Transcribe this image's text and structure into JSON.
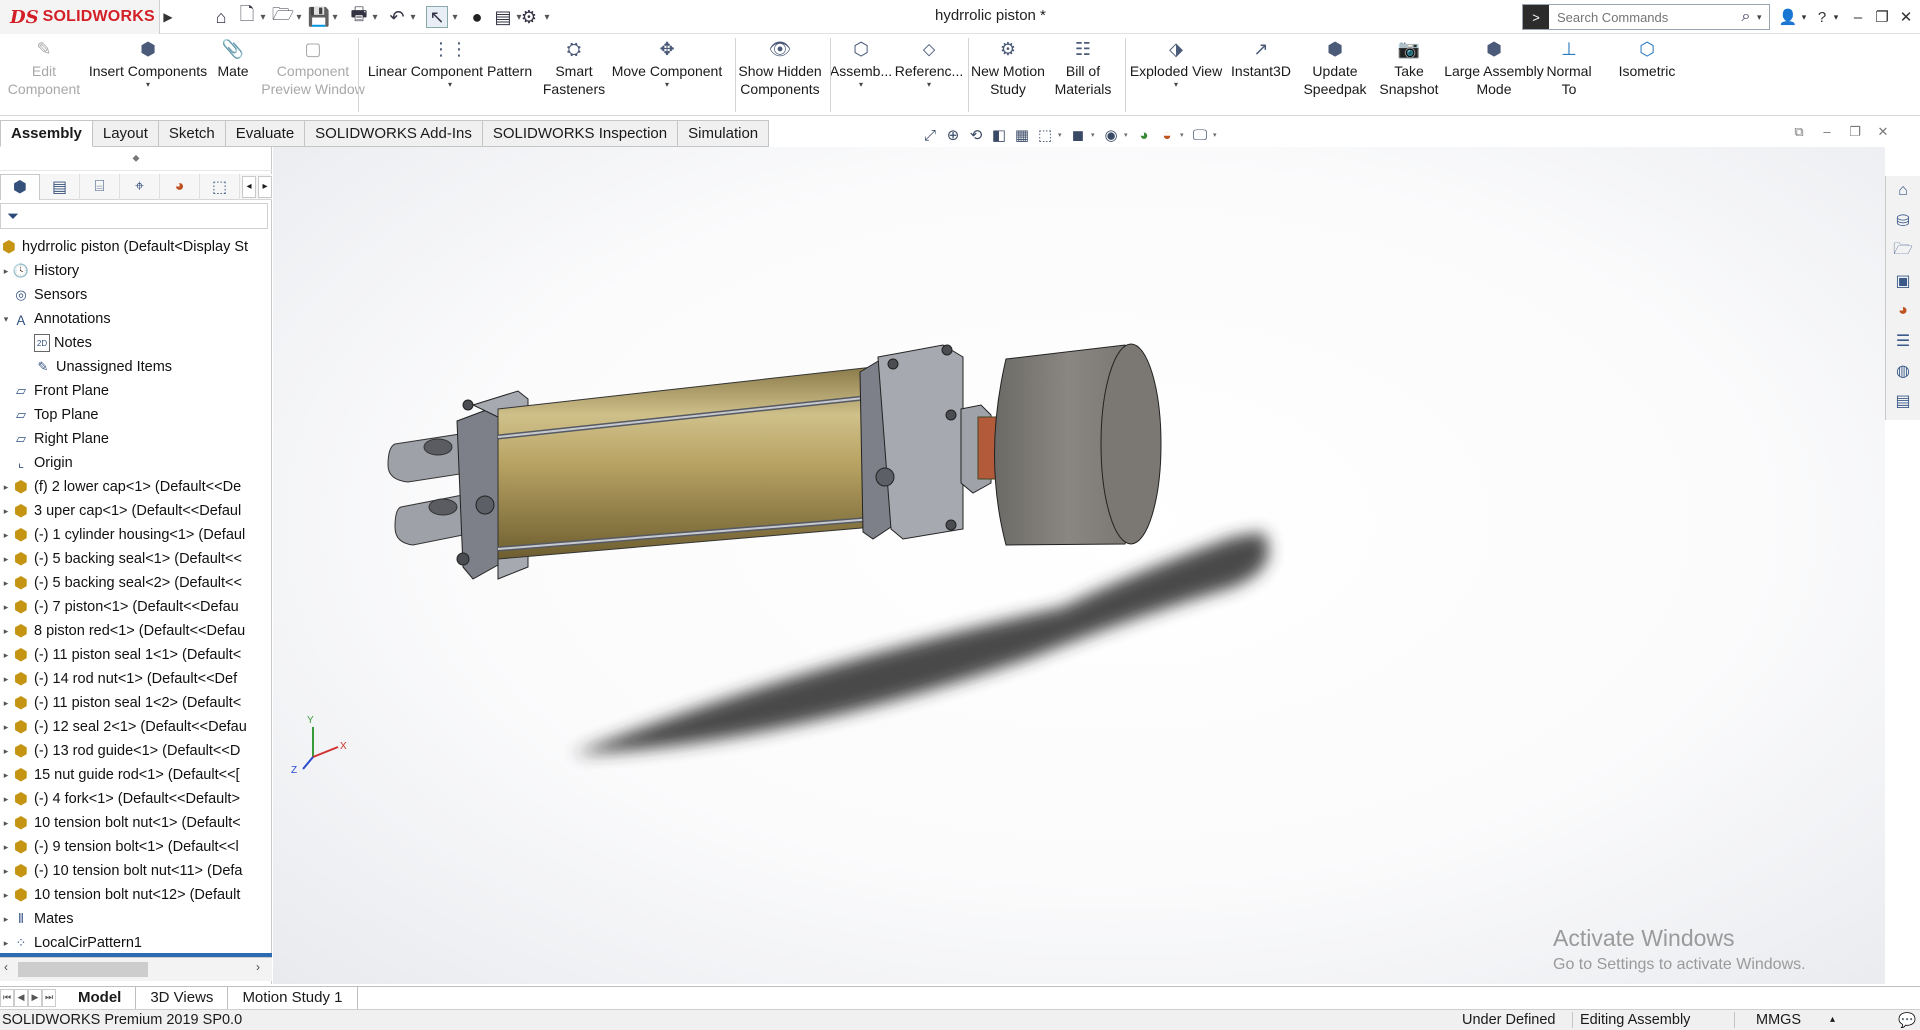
{
  "app": {
    "brand_mark": "DS",
    "brand_name": "SOLIDWORKS",
    "document_title": "hydrrolic piston *"
  },
  "search": {
    "placeholder": "Search Commands"
  },
  "command_manager": [
    {
      "label": "Edit\nComponent",
      "icon": "edit-component-icon",
      "enabled": false
    },
    {
      "label": "Insert Components",
      "icon": "insert-components-icon",
      "enabled": true
    },
    {
      "label": "Mate",
      "icon": "mate-icon",
      "enabled": true
    },
    {
      "label": "Component\nPreview Window",
      "icon": "preview-window-icon",
      "enabled": false
    },
    {
      "label": "Linear Component Pattern",
      "icon": "linear-pattern-icon",
      "enabled": true
    },
    {
      "label": "Smart\nFasteners",
      "icon": "smart-fasteners-icon",
      "enabled": true
    },
    {
      "label": "Move Component",
      "icon": "move-component-icon",
      "enabled": true
    },
    {
      "label": "Show Hidden\nComponents",
      "icon": "show-hidden-icon",
      "enabled": true
    },
    {
      "label": "Assemb...",
      "icon": "assembly-features-icon",
      "enabled": true
    },
    {
      "label": "Referenc...",
      "icon": "reference-geometry-icon",
      "enabled": true
    },
    {
      "label": "New Motion\nStudy",
      "icon": "motion-study-icon",
      "enabled": true
    },
    {
      "label": "Bill of\nMaterials",
      "icon": "bom-icon",
      "enabled": true
    },
    {
      "label": "Exploded View",
      "icon": "exploded-view-icon",
      "enabled": true
    },
    {
      "label": "Instant3D",
      "icon": "instant3d-icon",
      "enabled": true
    },
    {
      "label": "Update\nSpeedpak",
      "icon": "speedpak-icon",
      "enabled": true
    },
    {
      "label": "Take\nSnapshot",
      "icon": "snapshot-icon",
      "enabled": true
    },
    {
      "label": "Large Assembly\nMode",
      "icon": "large-assembly-icon",
      "enabled": true
    },
    {
      "label": "Normal\nTo",
      "icon": "normal-to-icon",
      "enabled": true
    },
    {
      "label": "Isometric",
      "icon": "isometric-icon",
      "enabled": true
    }
  ],
  "ribbon_tabs": [
    "Assembly",
    "Layout",
    "Sketch",
    "Evaluate",
    "SOLIDWORKS Add-Ins",
    "SOLIDWORKS Inspection",
    "Simulation"
  ],
  "active_ribbon_tab": "Assembly",
  "feature_tree": {
    "root": "hydrrolic piston  (Default<Display St",
    "items": [
      {
        "label": "History",
        "icon": "history-icon",
        "expander": "▸",
        "indent": 0
      },
      {
        "label": "Sensors",
        "icon": "sensors-icon",
        "expander": "",
        "indent": 0
      },
      {
        "label": "Annotations",
        "icon": "annotations-icon",
        "expander": "▾",
        "indent": 0
      },
      {
        "label": "Notes",
        "icon": "notes-icon",
        "expander": "",
        "indent": 1
      },
      {
        "label": "Unassigned Items",
        "icon": "unassigned-items-icon",
        "expander": "",
        "indent": 1
      },
      {
        "label": "Front Plane",
        "icon": "plane-icon",
        "expander": "",
        "indent": 0
      },
      {
        "label": "Top Plane",
        "icon": "plane-icon",
        "expander": "",
        "indent": 0
      },
      {
        "label": "Right Plane",
        "icon": "plane-icon",
        "expander": "",
        "indent": 0
      },
      {
        "label": "Origin",
        "icon": "origin-icon",
        "expander": "",
        "indent": 0
      },
      {
        "label": "(f) 2 lower cap<1> (Default<<De",
        "icon": "part-icon",
        "expander": "▸",
        "indent": 0
      },
      {
        "label": "3 uper cap<1> (Default<<Defaul",
        "icon": "part-icon",
        "expander": "▸",
        "indent": 0
      },
      {
        "label": "(-) 1 cylinder housing<1> (Defaul",
        "icon": "part-icon",
        "expander": "▸",
        "indent": 0
      },
      {
        "label": "(-) 5 backing seal<1> (Default<<",
        "icon": "part-icon",
        "expander": "▸",
        "indent": 0
      },
      {
        "label": "(-) 5 backing seal<2> (Default<<",
        "icon": "part-icon",
        "expander": "▸",
        "indent": 0
      },
      {
        "label": "(-) 7 piston<1> (Default<<Defau",
        "icon": "part-icon",
        "expander": "▸",
        "indent": 0
      },
      {
        "label": "8 piston red<1> (Default<<Defau",
        "icon": "part-icon",
        "expander": "▸",
        "indent": 0
      },
      {
        "label": "(-) 11 piston seal 1<1> (Default<",
        "icon": "part-icon",
        "expander": "▸",
        "indent": 0
      },
      {
        "label": "(-) 14 rod nut<1> (Default<<Def",
        "icon": "part-icon",
        "expander": "▸",
        "indent": 0
      },
      {
        "label": "(-) 11 piston seal 1<2> (Default<",
        "icon": "part-icon",
        "expander": "▸",
        "indent": 0
      },
      {
        "label": "(-) 12 seal 2<1> (Default<<Defau",
        "icon": "part-icon",
        "expander": "▸",
        "indent": 0
      },
      {
        "label": "(-) 13 rod guide<1> (Default<<D",
        "icon": "part-icon",
        "expander": "▸",
        "indent": 0
      },
      {
        "label": "15 nut guide rod<1> (Default<<[",
        "icon": "part-icon",
        "expander": "▸",
        "indent": 0
      },
      {
        "label": "(-) 4 fork<1> (Default<<Default>",
        "icon": "part-icon",
        "expander": "▸",
        "indent": 0
      },
      {
        "label": "10 tension bolt nut<1> (Default<",
        "icon": "part-icon",
        "expander": "▸",
        "indent": 0
      },
      {
        "label": "(-) 9 tension bolt<1> (Default<<l",
        "icon": "part-icon",
        "expander": "▸",
        "indent": 0
      },
      {
        "label": "(-) 10 tension bolt nut<11> (Defa",
        "icon": "part-icon",
        "expander": "▸",
        "indent": 0
      },
      {
        "label": "10 tension bolt nut<12> (Default",
        "icon": "part-icon",
        "expander": "▸",
        "indent": 0
      },
      {
        "label": "Mates",
        "icon": "mates-icon",
        "expander": "▸",
        "indent": 0
      },
      {
        "label": "LocalCirPattern1",
        "icon": "pattern-icon",
        "expander": "▸",
        "indent": 0
      }
    ]
  },
  "triad": {
    "x": "X",
    "y": "Y",
    "z": "Z"
  },
  "watermark": {
    "title": "Activate Windows",
    "subtitle": "Go to Settings to activate Windows."
  },
  "bottom_tabs": [
    "Model",
    "3D Views",
    "Motion Study 1"
  ],
  "active_bottom_tab": "Model",
  "status": {
    "product": "SOLIDWORKS Premium 2019 SP0.0",
    "definition": "Under Defined",
    "mode": "Editing Assembly",
    "units": "MMGS"
  }
}
